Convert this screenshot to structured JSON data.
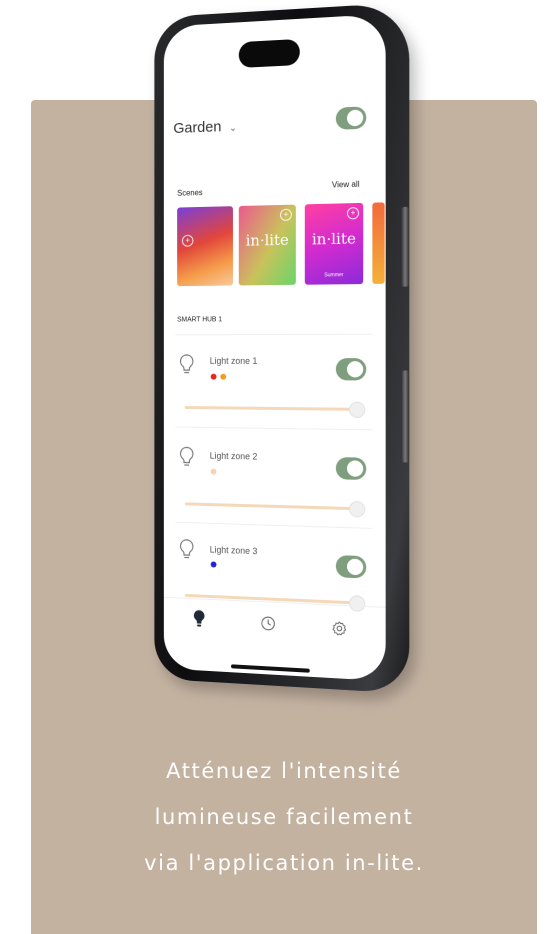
{
  "header": {
    "location": "Garden",
    "chevron_icon": "chevron-down-icon"
  },
  "scenes": {
    "label": "Scenes",
    "view_all": "View all",
    "items": [
      {
        "logo": "",
        "name": ""
      },
      {
        "logo": "in·lite",
        "name": ""
      },
      {
        "logo": "in·lite",
        "name": "Summer"
      }
    ]
  },
  "hub": {
    "label": "SMART HUB 1",
    "zones": [
      {
        "name": "Light zone 1",
        "dots": [
          "#e8261f",
          "#f39a1e"
        ]
      },
      {
        "name": "Light zone 2",
        "dots": [
          "#f6d2b0"
        ]
      },
      {
        "name": "Light zone 3",
        "dots": [
          "#2322d6"
        ]
      }
    ]
  },
  "nav": [
    "bulb-icon",
    "history-icon",
    "gear-icon"
  ],
  "caption": {
    "line1": "Atténuez l'intensité",
    "line2": "lumineuse facilement",
    "line3": "via l'application in-lite."
  },
  "colors": {
    "panel": "#c4b2a1",
    "toggle_on": "#7e9e7d",
    "slider": "#f3d9b9"
  }
}
